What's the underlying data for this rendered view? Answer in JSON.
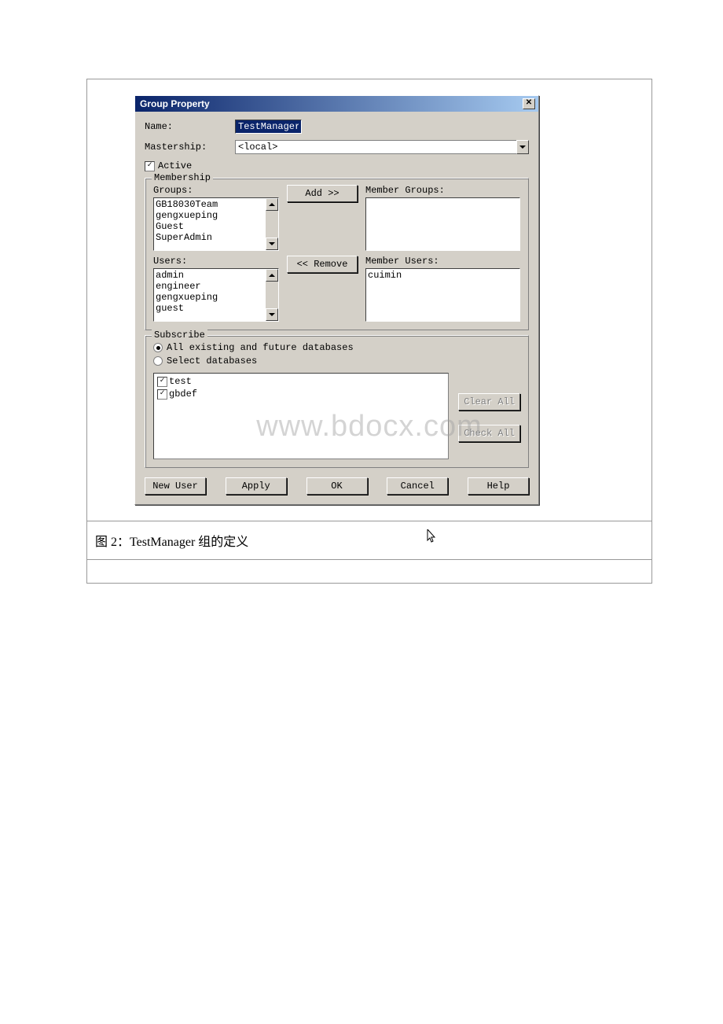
{
  "dialog": {
    "title": "Group Property",
    "close_label": "✕",
    "name_label": "Name:",
    "name_value": "TestManager",
    "mastership_label": "Mastership:",
    "mastership_value": "<local>",
    "active_label": "Active",
    "active_checked": true
  },
  "membership": {
    "legend": "Membership",
    "groups_label": "Groups:",
    "member_groups_label": "Member Groups:",
    "users_label": "Users:",
    "member_users_label": "Member Users:",
    "groups": [
      "GB18030Team",
      "gengxueping",
      "Guest",
      "SuperAdmin"
    ],
    "member_groups": [],
    "users": [
      "admin",
      "engineer",
      "gengxueping",
      "guest"
    ],
    "member_users": [
      "cuimin"
    ],
    "add_label": "Add >>",
    "remove_label": "<< Remove"
  },
  "subscribe": {
    "legend": "Subscribe",
    "radio_all": "All existing and future databases",
    "radio_select": "Select databases",
    "selected_radio": "all",
    "databases": [
      {
        "name": "test",
        "checked": true
      },
      {
        "name": "gbdef",
        "checked": true
      }
    ],
    "clear_all_label": "Clear All",
    "check_all_label": "Check All"
  },
  "buttons": {
    "new_user": "New User",
    "apply": "Apply",
    "ok": "OK",
    "cancel": "Cancel",
    "help": "Help"
  },
  "caption": "图 2：TestManager 组的定义",
  "watermark": "www.bdocx.com"
}
